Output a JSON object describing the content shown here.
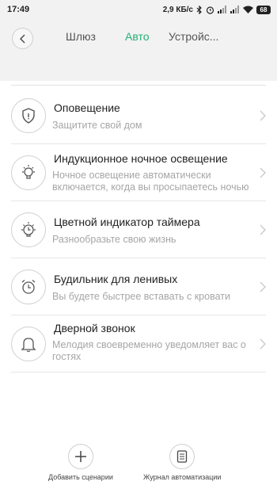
{
  "status_bar": {
    "time": "17:49",
    "network_speed": "2,9 КБ/с",
    "battery": "68"
  },
  "nav": {
    "tabs": [
      "Шлюз",
      "Авто",
      "Устройс..."
    ],
    "active_tab": "Авто",
    "active_color": "#24b176"
  },
  "list": [
    {
      "title": "Оповещение",
      "description": "Защитите свой дом",
      "icon": "shield-icon"
    },
    {
      "title": "Индукционное ночное освещение",
      "description": "Ночное освещение автоматически включается, когда вы просыпаетесь ночью",
      "icon": "lightbulb-icon"
    },
    {
      "title": "Цветной индикатор таймера",
      "description": "Разнообразьте свою жизнь",
      "icon": "timer-bulb-icon"
    },
    {
      "title": "Будильник для ленивых",
      "description": "Вы будете быстрее вставать с кровати",
      "icon": "alarm-clock-icon"
    },
    {
      "title": "Дверной звонок",
      "description": "Мелодия своевременно уведомляет вас о гостях",
      "icon": "bell-icon"
    }
  ],
  "bottom": {
    "add_label": "Добавить сценарии",
    "log_label": "Журнал автоматизации"
  }
}
